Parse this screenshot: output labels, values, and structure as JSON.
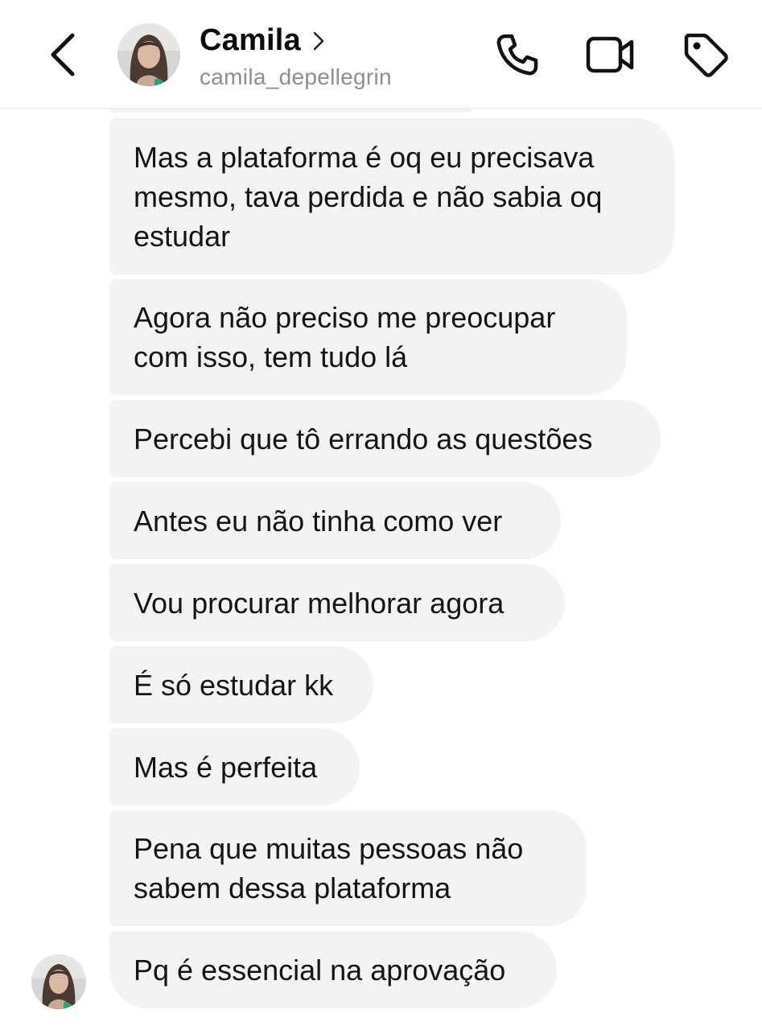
{
  "header": {
    "name": "Camila",
    "username": "camila_depellegrin"
  },
  "icons": {
    "back": "chevron-left-icon",
    "profile": "chevron-right-icon",
    "call": "phone-icon",
    "video": "video-camera-icon",
    "tag": "tag-icon"
  },
  "colors": {
    "bubble": "#f2f3f5",
    "subtitle": "#8e8e8e"
  },
  "messages": [
    "Mas a plataforma é oq eu precisava\nmesmo, tava perdida e não sabia oq\nestudar",
    "Agora não preciso me preocupar\ncom isso, tem tudo lá",
    "Percebi que tô errando as questões",
    "Antes eu não tinha como ver",
    "Vou procurar melhorar agora",
    "É só estudar kk",
    "Mas é perfeita",
    "Pena que muitas pessoas não\nsabem dessa plataforma",
    "Pq é essencial na aprovação"
  ]
}
